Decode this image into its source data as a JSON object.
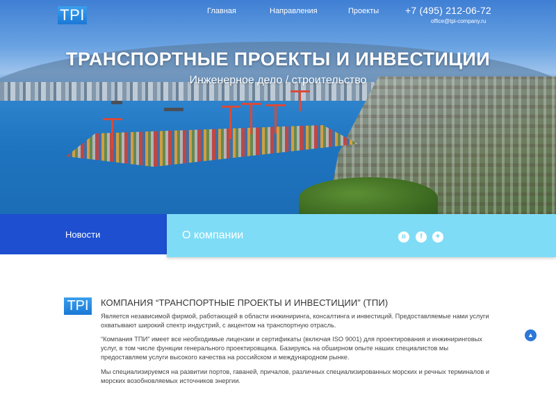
{
  "header": {
    "logo_text": "TPI",
    "nav": [
      "Главная",
      "Направления",
      "Проекты"
    ],
    "phone": "+7 (495) 212-06-72",
    "email": "office@tpi-company.ru"
  },
  "hero": {
    "title": "ТРАНСПОРТНЫЕ ПРОЕКТЫ И ИНВЕСТИЦИИ",
    "subtitle": "Инженерное дело / строительство"
  },
  "band": {
    "news_label": "Новости",
    "about_label": "О компании",
    "social": [
      {
        "icon": "vk-icon",
        "glyph": "в"
      },
      {
        "icon": "facebook-icon",
        "glyph": "f"
      },
      {
        "icon": "twitter-icon",
        "glyph": "✦"
      }
    ]
  },
  "content": {
    "logo_text": "TPI",
    "title": "КОМПАНИЯ “ТРАНСПОРТНЫЕ ПРОЕКТЫ И ИНВЕСТИЦИИ” (ТПИ)",
    "paragraphs": [
      "Является независимой фирмой, работающей в области инжиниринга, консалтинга и инвестиций. Предоставляемые нами услуги охватывают широкий спектр индустрий, с акцентом на транспортную отрасль.",
      "“Компания ТПИ” имеет все необходимые лицензии и сертификаты (включая ISO 9001) для проектирования и инжиниринговых услуг, в том числе функции генерального проектировщика. Базируясь на обширном опыте наших специалистов мы предоставляем услуги высокого качества на российском и международном рынке.",
      "Мы специализируемся на развитии портов, гаваней, причалов, различных специализированных морских и речных терминалов и морских возобновляемых источников энергии."
    ],
    "scroll_top_glyph": "▲"
  },
  "colors": {
    "news_band": "#1e4fd0",
    "about_band": "#7fdcf6",
    "logo_blue": "#1b78d6",
    "scroll_button": "#2d78d8"
  }
}
